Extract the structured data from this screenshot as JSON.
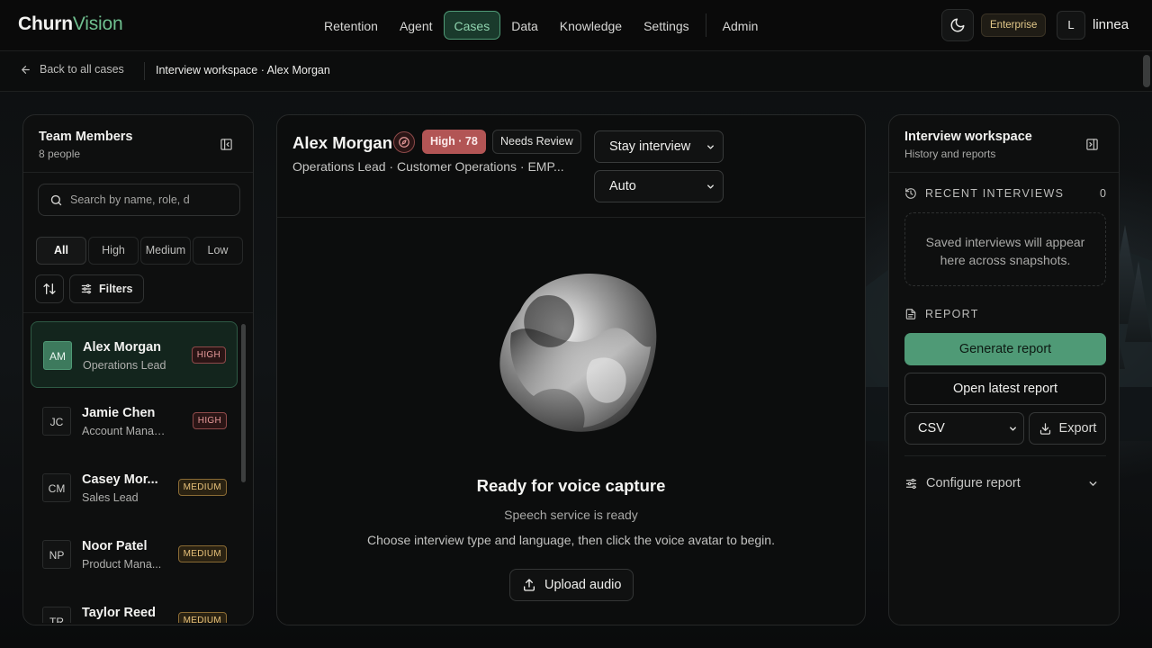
{
  "brand": {
    "part1": "Churn",
    "part2": "Vision"
  },
  "nav": {
    "items": [
      {
        "label": "Retention"
      },
      {
        "label": "Agent"
      },
      {
        "label": "Cases",
        "active": true
      },
      {
        "label": "Data"
      },
      {
        "label": "Knowledge"
      },
      {
        "label": "Settings"
      },
      {
        "label": "Admin"
      }
    ]
  },
  "header": {
    "plan_badge": "Enterprise",
    "user_initial": "L",
    "username": "linnea",
    "theme_icon": "moon-icon"
  },
  "subbar": {
    "back_label": "Back to all cases",
    "breadcrumb": "Interview workspace · Alex Morgan"
  },
  "team": {
    "title": "Team Members",
    "count": "8 people",
    "search_placeholder": "Search by name, role, d",
    "filters": [
      "All",
      "High",
      "Medium",
      "Low"
    ],
    "active_filter": "All",
    "filters_label": "Filters",
    "members": [
      {
        "initials": "AM",
        "name": "Alex Morgan",
        "role": "Operations Lead",
        "risk": "HIGH",
        "selected": true
      },
      {
        "initials": "JC",
        "name": "Jamie Chen",
        "role": "Account Manager",
        "risk": "HIGH"
      },
      {
        "initials": "CM",
        "name": "Casey Mor...",
        "role": "Sales Lead",
        "risk": "MEDIUM"
      },
      {
        "initials": "NP",
        "name": "Noor Patel",
        "role": "Product Mana...",
        "risk": "MEDIUM"
      },
      {
        "initials": "TR",
        "name": "Taylor Reed",
        "role": "",
        "risk": "MEDIUM"
      }
    ]
  },
  "case": {
    "name": "Alex Morgan",
    "risk_badge": "High · 78",
    "status": "Needs Review",
    "meta": "Operations Lead · Customer Operations · EMP...",
    "interview_type": "Stay interview",
    "language": "Auto",
    "ready_title": "Ready for voice capture",
    "speech_status": "Speech service is ready",
    "instructions": "Choose interview type and language, then click the voice avatar to begin.",
    "upload_label": "Upload audio"
  },
  "workspace": {
    "title": "Interview workspace",
    "subtitle": "History and reports",
    "recent_label": "RECENT INTERVIEWS",
    "recent_count": "0",
    "recent_empty": "Saved interviews will appear here across snapshots.",
    "report_label": "REPORT",
    "generate_label": "Generate report",
    "open_label": "Open latest report",
    "format": "CSV",
    "export_label": "Export",
    "configure_label": "Configure report"
  },
  "colors": {
    "accent": "#4f9a76",
    "high": "#b25555",
    "medium": "#e8c27a",
    "background": "#0b0c0c"
  }
}
